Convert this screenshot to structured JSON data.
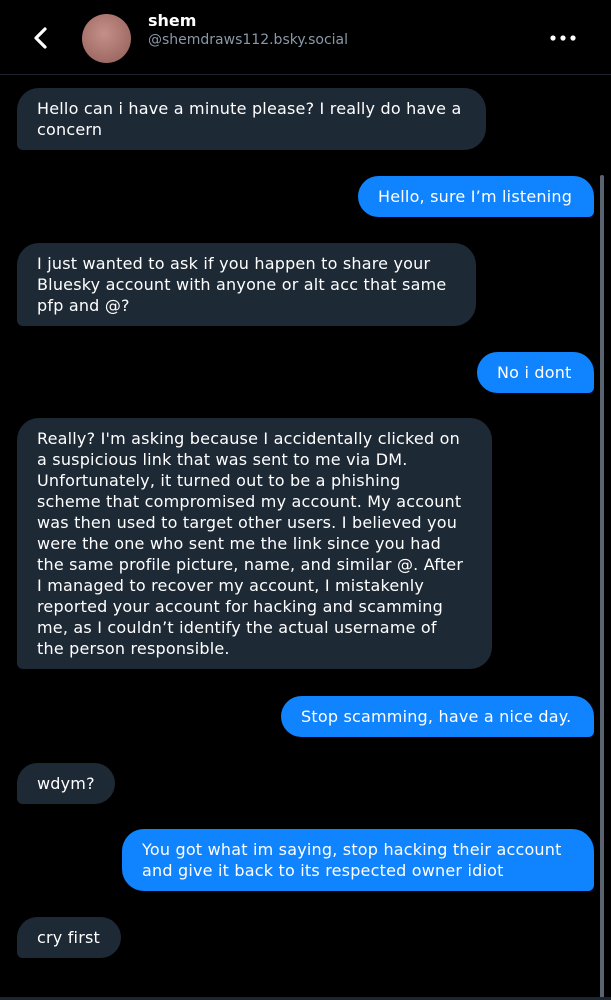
{
  "header": {
    "back_icon": "chevron-left-icon",
    "display_name": "shem",
    "handle": "@shemdraws112.bsky.social",
    "more_icon": "ellipsis-horizontal-icon"
  },
  "messages": [
    {
      "sender": "them",
      "lines": [
        "Hello can i have a minute please? I really do have a",
        "concern"
      ]
    },
    {
      "sender": "me",
      "lines": [
        "Hello, sure I’m listening"
      ]
    },
    {
      "sender": "them",
      "lines": [
        "I just wanted to ask if you happen to share your",
        "Bluesky account with anyone or alt acc that same",
        "pfp and @?"
      ]
    },
    {
      "sender": "me",
      "lines": [
        "No i dont"
      ]
    },
    {
      "sender": "them",
      "lines": [
        "Really? I'm asking because I accidentally clicked on",
        "a suspicious link that was sent to me via DM.",
        "Unfortunately, it turned out to be a phishing",
        "scheme that compromised my account. My account",
        "was then used to target other users. I believed you",
        "were the one who sent me the link since you had",
        "the same profile picture, name, and similar @. After",
        "I managed to recover my account, I mistakenly",
        "reported your account for hacking and scamming",
        "me, as I couldn’t identify the actual username of",
        "the person responsible."
      ]
    },
    {
      "sender": "me",
      "lines": [
        "Stop scamming, have a nice day."
      ]
    },
    {
      "sender": "them",
      "lines": [
        "wdym?"
      ]
    },
    {
      "sender": "me",
      "lines": [
        "You got what im saying, stop hacking their account",
        "and give it back to its respected owner idiot"
      ]
    },
    {
      "sender": "them",
      "lines": [
        "cry first"
      ]
    }
  ],
  "colors": {
    "background": "#000000",
    "incoming_bubble": "#1e2936",
    "outgoing_bubble": "#1083fe",
    "handle_text": "#8a98a8"
  }
}
